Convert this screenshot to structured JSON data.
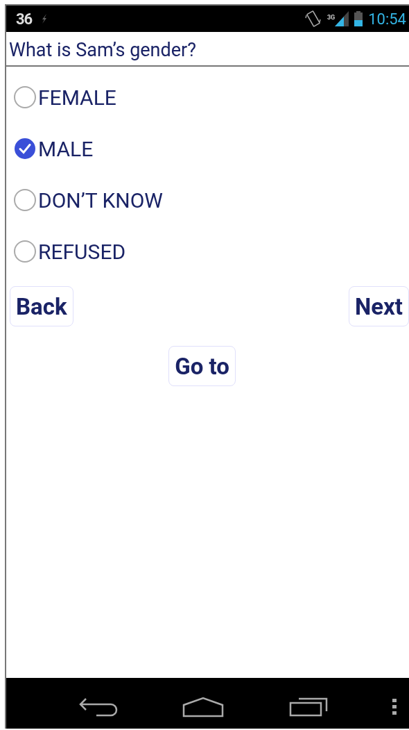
{
  "status_bar": {
    "notification": "36",
    "network": "3G",
    "time": "10:54"
  },
  "question": "What is Sam’s gender?",
  "options": [
    {
      "label": "FEMALE",
      "selected": false
    },
    {
      "label": "MALE",
      "selected": true
    },
    {
      "label": "DON’T KNOW",
      "selected": false
    },
    {
      "label": "REFUSED",
      "selected": false
    }
  ],
  "buttons": {
    "back": "Back",
    "next": "Next",
    "goto": "Go to"
  }
}
